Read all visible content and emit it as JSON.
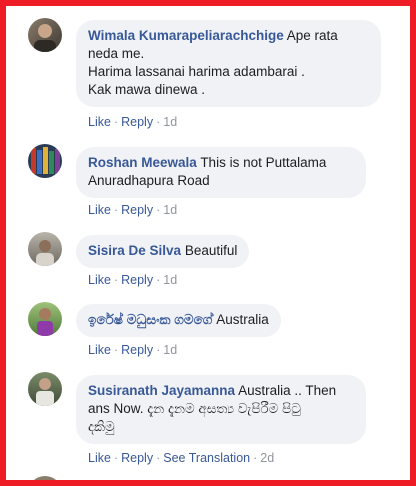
{
  "comments": [
    {
      "author": "Wimala Kumarapeliarachchige",
      "text_lines": [
        "Ape rata",
        "neda me.",
        "Harima lassanai harima adambarai .",
        "Kak mawa dinewa ."
      ],
      "actions": {
        "like": "Like",
        "reply": "Reply",
        "time": "1d"
      }
    },
    {
      "author": "Roshan Meewala",
      "text_lines": [
        "This is not Puttalama",
        "Anuradhapura Road"
      ],
      "actions": {
        "like": "Like",
        "reply": "Reply",
        "time": "1d"
      }
    },
    {
      "author": "Sisira De Silva",
      "text_lines": [
        "Beautiful"
      ],
      "actions": {
        "like": "Like",
        "reply": "Reply",
        "time": "1d"
      }
    },
    {
      "author": "ඉරේෂ් මධුසංක ගමගේ",
      "text_lines": [
        "Australia"
      ],
      "actions": {
        "like": "Like",
        "reply": "Reply",
        "time": "1d"
      }
    },
    {
      "author": "Susiranath Jayamanna",
      "text_lines": [
        "Australia .. Then",
        "ans Now. දැන දැනම අසත්‍ය වැපිරීම පිටු",
        "දකිමු"
      ],
      "actions": {
        "like": "Like",
        "reply": "Reply",
        "see_translation": "See Translation",
        "time": "2d"
      }
    }
  ],
  "colors": {
    "border": "#ee1c24",
    "link": "#385898",
    "bubble": "#f0f2f5",
    "muted": "#90949c"
  }
}
